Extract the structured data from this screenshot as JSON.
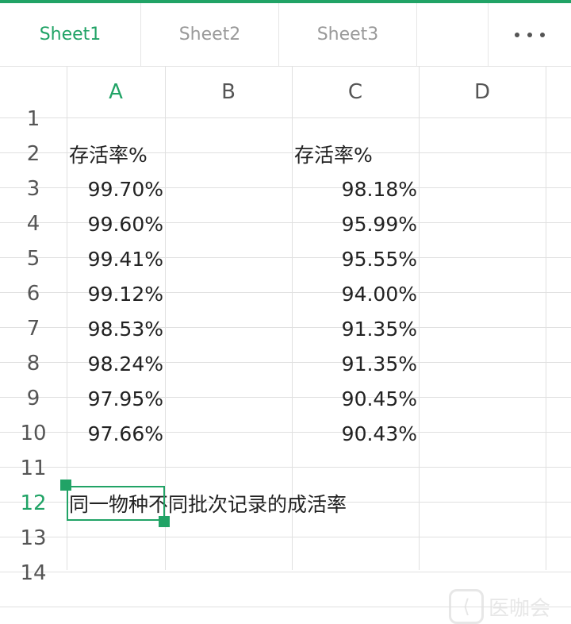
{
  "tabs": [
    {
      "label": "Sheet1",
      "active": true
    },
    {
      "label": "Sheet2",
      "active": false
    },
    {
      "label": "Sheet3",
      "active": false
    }
  ],
  "columns": [
    "A",
    "B",
    "C",
    "D"
  ],
  "active_column": "A",
  "rows": [
    "1",
    "2",
    "3",
    "4",
    "5",
    "6",
    "7",
    "8",
    "9",
    "10",
    "11",
    "12",
    "13",
    "14"
  ],
  "active_row": "12",
  "cells": {
    "A2": "存活率%",
    "C2": "存活率%",
    "A3": "99.70%",
    "C3": "98.18%",
    "A4": "99.60%",
    "C4": "95.99%",
    "A5": "99.41%",
    "C5": "95.55%",
    "A6": "99.12%",
    "C6": "94.00%",
    "A7": "98.53%",
    "C7": "91.35%",
    "A8": "98.24%",
    "C8": "91.35%",
    "A9": "97.95%",
    "C9": "90.45%",
    "A10": "97.66%",
    "C10": "90.43%",
    "A12": "同一物种不同批次记录的成活率"
  },
  "accent_color": "#21a366",
  "watermark": {
    "text": "医咖会"
  }
}
